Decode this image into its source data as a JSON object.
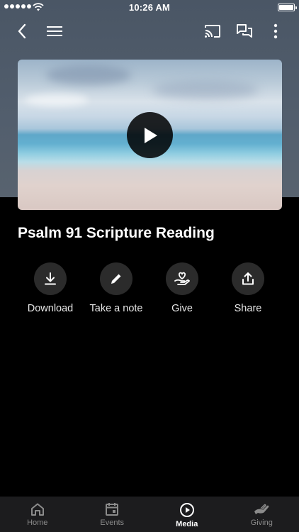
{
  "status_bar": {
    "time": "10:26 AM"
  },
  "nav": {
    "icons": [
      "chevron-left-icon",
      "menu-icon",
      "cast-icon",
      "chat-icon",
      "more-vertical-icon"
    ]
  },
  "video": {
    "thumbnail": "beach-ocean-thumbnail",
    "play_icon": "play-icon"
  },
  "media": {
    "title": "Psalm 91 Scripture Reading"
  },
  "actions": [
    {
      "label": "Download",
      "icon": "download-icon"
    },
    {
      "label": "Take a note",
      "icon": "pencil-icon"
    },
    {
      "label": "Give",
      "icon": "heart-hand-icon"
    },
    {
      "label": "Share",
      "icon": "share-icon"
    }
  ],
  "tabbar": {
    "tabs": [
      {
        "label": "Home",
        "icon": "home-icon",
        "active": false
      },
      {
        "label": "Events",
        "icon": "calendar-icon",
        "active": false
      },
      {
        "label": "Media",
        "icon": "play-circle-icon",
        "active": true
      },
      {
        "label": "Giving",
        "icon": "giving-hand-icon",
        "active": false
      }
    ]
  },
  "colors": {
    "header_bg": "#525e6d",
    "page_bg": "#000000",
    "action_circle": "#2b2b2b",
    "tabbar_bg": "#1c1c1e",
    "tab_inactive": "#8b8b8b",
    "tab_active": "#ffffff"
  }
}
